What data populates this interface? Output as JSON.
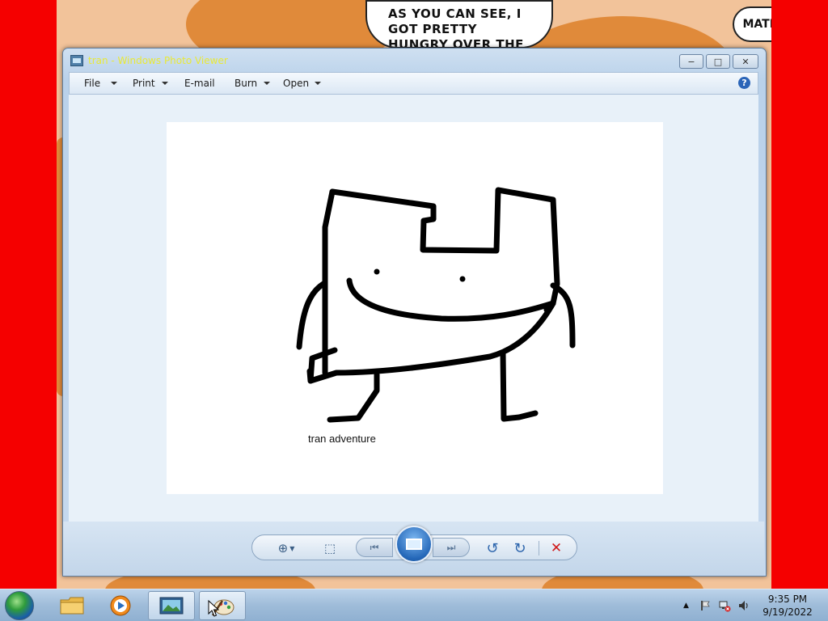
{
  "wallpaper": {
    "speech_text": "AS YOU CAN SEE, I GOT PRETTY HUNGRY OVER THE HOLIDAY!",
    "thought_text": "MATHS..."
  },
  "window": {
    "title": "tran - Windows Photo Viewer",
    "controls": {
      "minimize": "−",
      "maximize": "□",
      "close": "✕"
    }
  },
  "menubar": {
    "items": [
      {
        "label": "File",
        "has_dropdown": true
      },
      {
        "label": "Print",
        "has_dropdown": true
      },
      {
        "label": "E-mail",
        "has_dropdown": false
      },
      {
        "label": "Burn",
        "has_dropdown": true
      },
      {
        "label": "Open",
        "has_dropdown": true
      }
    ],
    "help_glyph": "?"
  },
  "image": {
    "caption": "tran adventure"
  },
  "controls": {
    "zoom_glyph": "⊕",
    "actual_size_glyph": "⬚",
    "previous_glyph": "⏮",
    "next_glyph": "⏭",
    "rotate_ccw_glyph": "↺",
    "rotate_cw_glyph": "↻",
    "delete_glyph": "✕"
  },
  "taskbar": {
    "pinned": [
      {
        "name": "windows-explorer",
        "icon": "folder-icon"
      },
      {
        "name": "media-player",
        "icon": "media-player-icon"
      },
      {
        "name": "photo-viewer",
        "icon": "photo-viewer-icon",
        "active": true
      },
      {
        "name": "paint",
        "icon": "paint-icon"
      }
    ],
    "clock_time": "9:35 PM",
    "clock_date": "9/19/2022"
  },
  "colors": {
    "desktop_background": "#f50000",
    "title_text": "#e9e936",
    "delete_red": "#d01a1a"
  }
}
